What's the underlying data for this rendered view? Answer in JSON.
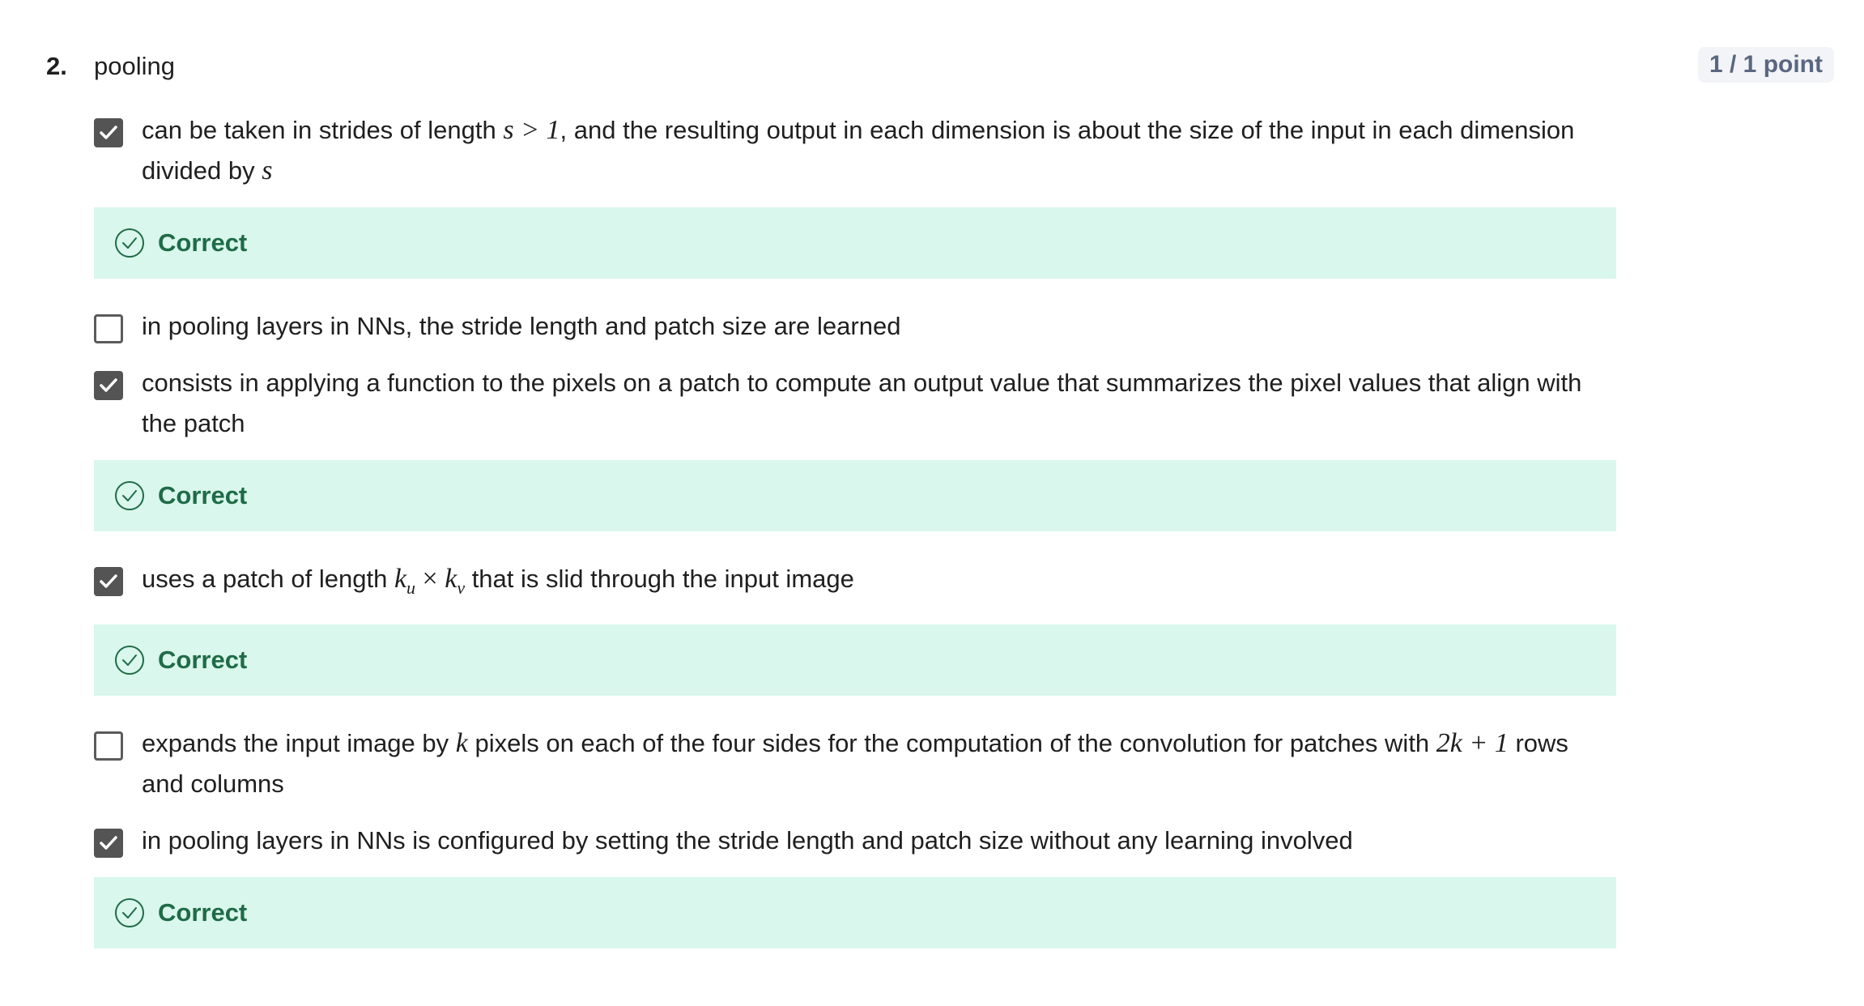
{
  "question": {
    "number": "2.",
    "title": "pooling",
    "points": "1 / 1 point"
  },
  "options": [
    {
      "checked": true,
      "text_parts": [
        "can be taken in strides of length ",
        "s > 1",
        ", and the resulting output in each dimension is about the size of the input in each dimension divided by ",
        "s"
      ],
      "feedback": "Correct"
    },
    {
      "checked": false,
      "text": "in pooling layers in NNs, the stride length and patch size are learned"
    },
    {
      "checked": true,
      "text": "consists in applying a function to the pixels on a patch to compute an output value that summarizes the pixel values that align with the patch",
      "feedback": "Correct"
    },
    {
      "checked": true,
      "text_parts": [
        "uses a patch of length ",
        "k",
        "u",
        "×",
        "k",
        "v",
        " that is slid through the input image"
      ],
      "feedback": "Correct"
    },
    {
      "checked": false,
      "text_parts": [
        "expands the input image by ",
        "k",
        " pixels on each of the four sides for the computation of the convolution for patches with ",
        "2k + 1",
        " rows and columns"
      ]
    },
    {
      "checked": true,
      "text": "in pooling layers in NNs is configured by setting the stride length and patch size without any learning involved",
      "feedback": "Correct"
    }
  ],
  "colors": {
    "feedback_bg": "#d9f7ec",
    "feedback_text": "#1f6b48",
    "checkbox_checked": "#545454",
    "points_badge_bg": "#f2f4f8"
  },
  "icons": {
    "checkbox_mark": "checkmark-icon",
    "feedback": "check-circle-icon"
  }
}
